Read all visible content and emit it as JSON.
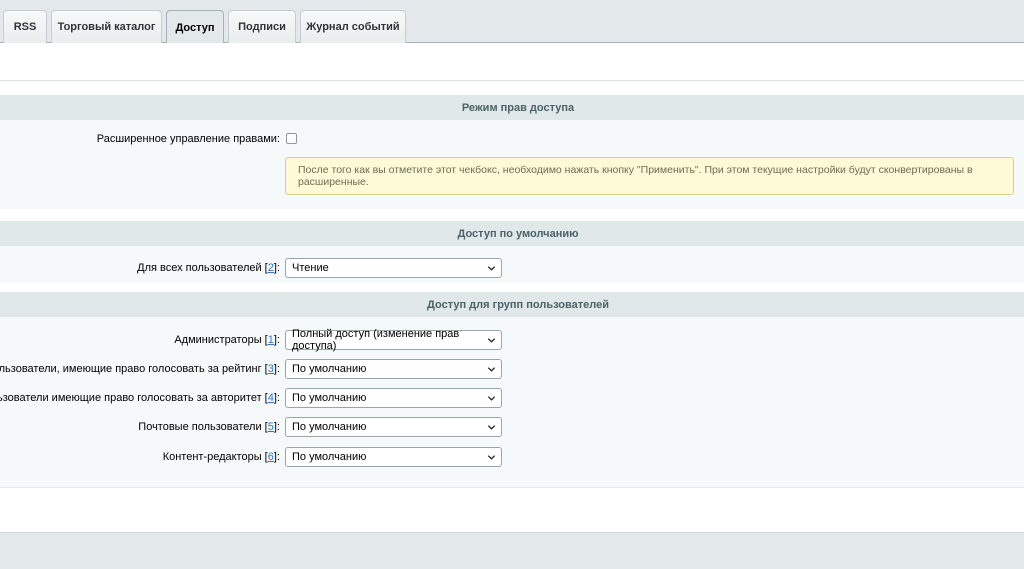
{
  "tabs": [
    {
      "label": "RSS",
      "active": false
    },
    {
      "label": "Торговый каталог",
      "active": false
    },
    {
      "label": "Доступ",
      "active": true
    },
    {
      "label": "Подписи",
      "active": false
    },
    {
      "label": "Журнал событий",
      "active": false
    }
  ],
  "mode_section": {
    "title": "Режим прав доступа",
    "extended_label": "Расширенное управление правами:",
    "extended_checked": false,
    "notice": "После того как вы отметите этот чекбокс, необходимо нажать кнопку \"Применить\". При этом текущие настройки будут сконвертированы в расширенные."
  },
  "default_section": {
    "title": "Доступ по умолчанию",
    "row": {
      "label": "Для всех пользователей",
      "ref": "2",
      "value": "Чтение"
    }
  },
  "groups_section": {
    "title": "Доступ для групп пользователей",
    "rows": [
      {
        "label": "Администраторы",
        "ref": "1",
        "value": "Полный доступ (изменение прав доступа)"
      },
      {
        "label": "Пользователи, имеющие право голосовать за рейтинг",
        "ref": "3",
        "value": "По умолчанию"
      },
      {
        "label": "Пользователи имеющие право голосовать за авторитет",
        "ref": "4",
        "value": "По умолчанию"
      },
      {
        "label": "Почтовые пользователи",
        "ref": "5",
        "value": "По умолчанию"
      },
      {
        "label": "Контент-редакторы",
        "ref": "6",
        "value": "По умолчанию"
      }
    ]
  },
  "colors": {
    "link": "#2675d7",
    "section_head": "#e0e8ea",
    "notice_bg": "#fef9d7"
  }
}
